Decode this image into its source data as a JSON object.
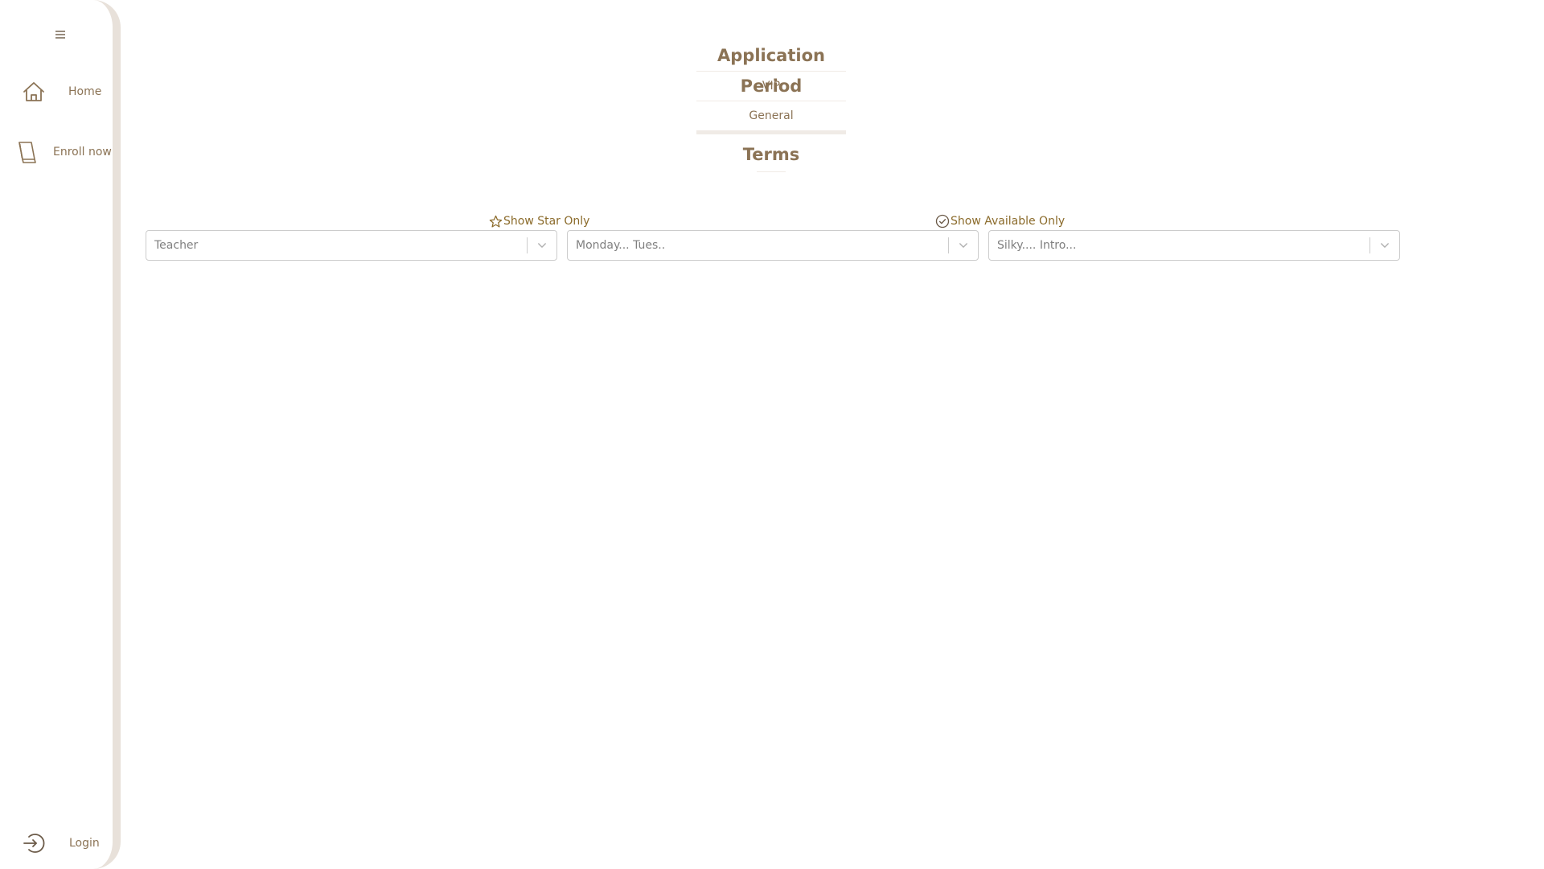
{
  "sidebar": {
    "menu_icon": "hamburger-icon",
    "items": [
      {
        "label": "Home",
        "icon": "home-icon"
      },
      {
        "label": "Enroll now",
        "icon": "book-icon"
      }
    ],
    "footer": {
      "label": "Login",
      "icon": "login-icon"
    }
  },
  "application_period": {
    "title": "Application Period",
    "options": [
      "VIP",
      "General"
    ]
  },
  "terms": {
    "title": "Terms"
  },
  "filters": {
    "star_toggle_label": "Show Star Only",
    "available_toggle_label": "Show Available Only",
    "teacher_placeholder": "Teacher",
    "day_placeholder": "Monday... Tues..",
    "class_placeholder": "Silky.... Intro..."
  },
  "colors": {
    "text": "#8b7355",
    "toggle": "#8b6b2b",
    "sidebar_border": "#e8e1da",
    "select_border": "#cccccc"
  }
}
